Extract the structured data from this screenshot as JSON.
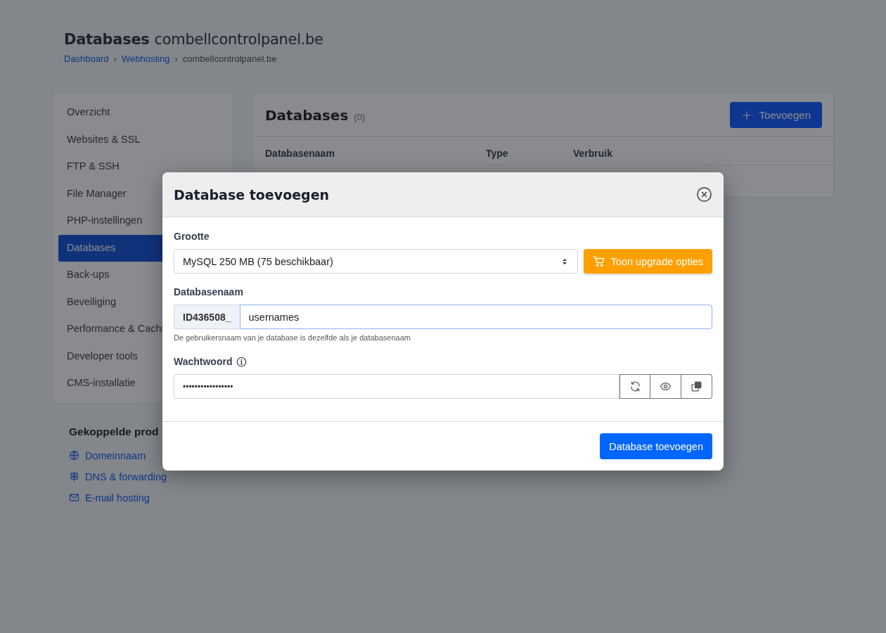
{
  "page": {
    "title": "Databases",
    "subtitle": "combellcontrolpanel.be",
    "breadcrumbs": [
      {
        "label": "Dashboard",
        "kind": "link"
      },
      {
        "label": "›",
        "kind": "separator"
      },
      {
        "label": "Webhosting",
        "kind": "link"
      },
      {
        "label": "›",
        "kind": "separator"
      },
      {
        "label": "combellcontrolpanel.be",
        "kind": "current"
      }
    ]
  },
  "sidebar": {
    "items": [
      {
        "label": "Overzicht",
        "selected": false
      },
      {
        "label": "Websites & SSL",
        "selected": false
      },
      {
        "label": "FTP & SSH",
        "selected": false
      },
      {
        "label": "File Manager",
        "selected": false
      },
      {
        "label": "PHP-instellingen",
        "selected": false
      },
      {
        "label": "Databases",
        "selected": true
      },
      {
        "label": "Back-ups",
        "selected": false
      },
      {
        "label": "Beveiliging",
        "selected": false
      },
      {
        "label": "Performance & Cachi",
        "selected": false
      },
      {
        "label": "Developer tools",
        "selected": false
      },
      {
        "label": "CMS-installatie",
        "selected": false
      }
    ]
  },
  "linked_products": {
    "title": "Gekoppelde prod",
    "links": [
      {
        "label": "Domeinnaam",
        "kind": "globe"
      },
      {
        "label": "DNS & forwarding",
        "kind": "signpost"
      },
      {
        "label": "E-mail hosting",
        "kind": "mail"
      }
    ]
  },
  "panel": {
    "title": "Databases",
    "count": "(0)",
    "add_button": "Toevoegen",
    "columns": [
      "Databasenaam",
      "Type",
      "Verbruik"
    ]
  },
  "modal": {
    "title": "Database toevoegen",
    "size": {
      "label": "Grootte",
      "value": "MySQL 250 MB (75 beschikbaar)",
      "upgrade_button": "Toon upgrade opties"
    },
    "name": {
      "label": "Databasenaam",
      "prefix": "ID436508_",
      "value": "usernames",
      "help": "De gebruikersnaam van je database is dezelfde als je databasenaam"
    },
    "password": {
      "label": "Wachtwoord",
      "value": "•••••••••••••••••"
    },
    "submit": "Database toevoegen"
  }
}
